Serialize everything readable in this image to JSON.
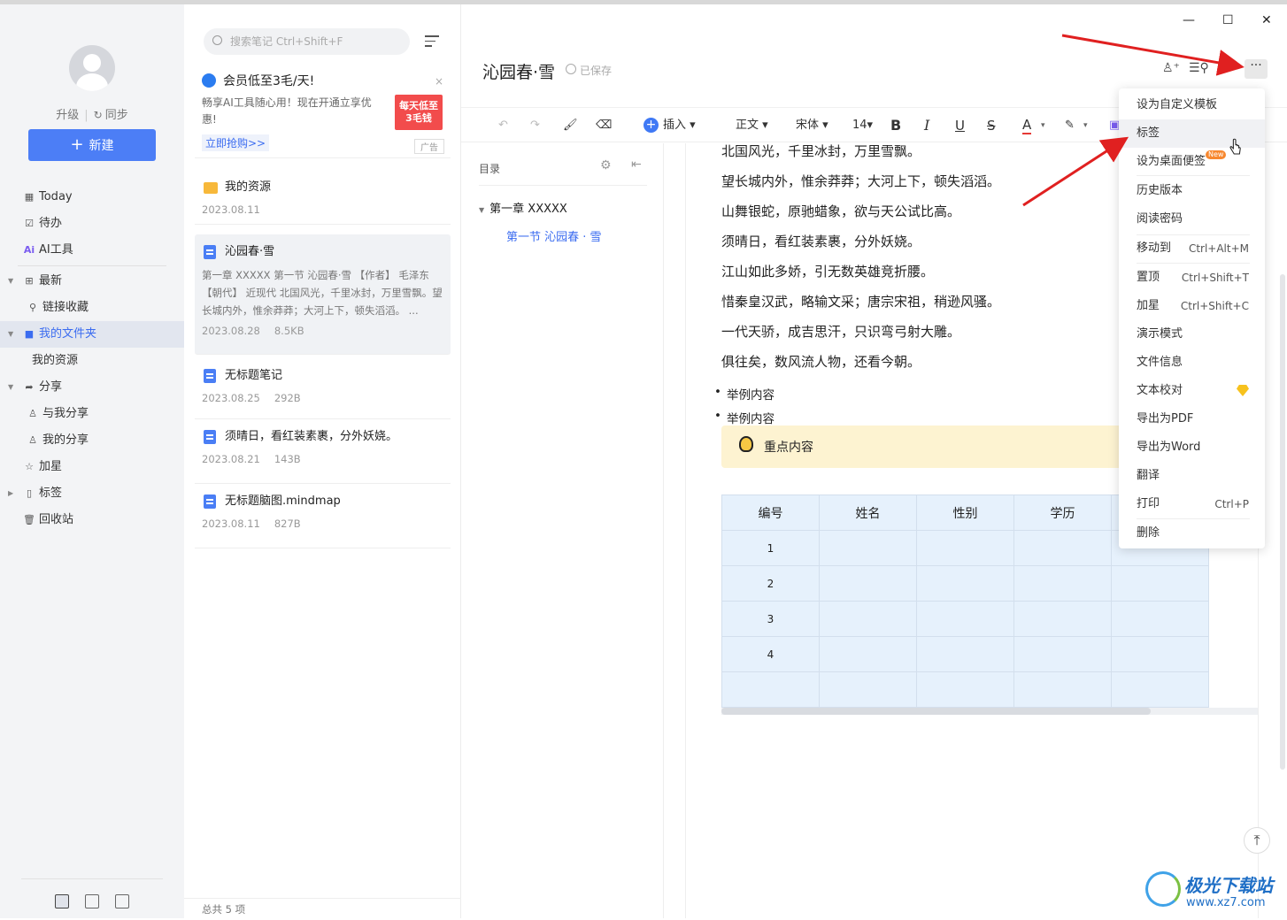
{
  "sidebar": {
    "upgrade": "升级",
    "sync": "同步",
    "new_button": "新建",
    "items": [
      {
        "label": "Today"
      },
      {
        "label": "待办"
      },
      {
        "label": "AI工具"
      },
      {
        "label": "最新"
      },
      {
        "label": "链接收藏"
      },
      {
        "label": "我的文件夹"
      },
      {
        "label": "我的资源"
      },
      {
        "label": "分享"
      },
      {
        "label": "与我分享"
      },
      {
        "label": "我的分享"
      },
      {
        "label": "加星"
      },
      {
        "label": "标签"
      },
      {
        "label": "回收站"
      }
    ]
  },
  "notelist": {
    "search_placeholder": "搜索笔记 Ctrl+Shift+F",
    "ad": {
      "title": "会员低至3毛/天!",
      "text": "畅享AI工具随心用！现在开通立享优惠!",
      "link": "立即抢购>>",
      "image_line1": "每天低至",
      "image_line2": "3毛钱",
      "tag": "广告"
    },
    "notes": [
      {
        "title": "我的资源",
        "date": "2023.08.11",
        "size": "",
        "snippet": ""
      },
      {
        "title": "沁园春·雪",
        "date": "2023.08.28",
        "size": "8.5KB",
        "snippet": "第一章 XXXXX 第一节 沁园春·雪 【作者】 毛泽东 【朝代】 近现代 北国风光，千里冰封，万里雪飘。望长城内外，惟余莽莽；大河上下，顿失滔滔。 ..."
      },
      {
        "title": "无标题笔记",
        "date": "2023.08.25",
        "size": "292B",
        "snippet": ""
      },
      {
        "title": "须晴日，看红装素裹，分外妖娆。",
        "date": "2023.08.21",
        "size": "143B",
        "snippet": ""
      },
      {
        "title": "无标题脑图.mindmap",
        "date": "2023.08.11",
        "size": "827B",
        "snippet": ""
      }
    ],
    "footer": "总共 5 项"
  },
  "editor": {
    "title": "沁园春·雪",
    "saved": "已保存",
    "toolbar": {
      "insert": "插入",
      "style": "正文",
      "font": "宋体",
      "size": "14",
      "bold": "B",
      "italic": "I",
      "underline": "U",
      "strike": "S",
      "color": "A"
    },
    "outline": {
      "label": "目录",
      "chapter": "第一章  XXXXX",
      "section": "第一节 沁园春 · 雪"
    },
    "poem": [
      "北国风光，千里冰封，万里雪飘。",
      "望长城内外，惟余莽莽；大河上下，顿失滔滔。",
      "山舞银蛇，原驰蜡象，欲与天公试比高。",
      "须晴日，看红装素裹，分外妖娆。",
      "江山如此多娇，引无数英雄竞折腰。",
      "惜秦皇汉武，略输文采；唐宗宋祖，稍逊风骚。",
      "一代天骄，成吉思汗，只识弯弓射大雕。",
      "俱往矣，数风流人物，还看今朝。"
    ],
    "bullets": [
      "举例内容",
      "举例内容"
    ],
    "callout": "重点内容",
    "table": {
      "headers": [
        "编号",
        "姓名",
        "性别",
        "学历",
        ""
      ],
      "rows": [
        [
          "1",
          "",
          "",
          "",
          ""
        ],
        [
          "2",
          "",
          "",
          "",
          ""
        ],
        [
          "3",
          "",
          "",
          "",
          ""
        ],
        [
          "4",
          "",
          "",
          "",
          ""
        ],
        [
          "",
          "",
          "",
          "",
          ""
        ]
      ]
    }
  },
  "menu": {
    "items": [
      {
        "label": "设为自定义模板",
        "shortcut": ""
      },
      {
        "label": "标签",
        "shortcut": ""
      },
      {
        "label": "设为桌面便签",
        "shortcut": "",
        "badge": "New"
      },
      {
        "label": "历史版本",
        "shortcut": ""
      },
      {
        "label": "阅读密码",
        "shortcut": ""
      },
      {
        "label": "移动到",
        "shortcut": "Ctrl+Alt+M"
      },
      {
        "label": "置顶",
        "shortcut": "Ctrl+Shift+T"
      },
      {
        "label": "加星",
        "shortcut": "Ctrl+Shift+C"
      },
      {
        "label": "演示模式",
        "shortcut": ""
      },
      {
        "label": "文件信息",
        "shortcut": ""
      },
      {
        "label": "文本校对",
        "shortcut": ""
      },
      {
        "label": "导出为PDF",
        "shortcut": ""
      },
      {
        "label": "导出为Word",
        "shortcut": ""
      },
      {
        "label": "翻译",
        "shortcut": ""
      },
      {
        "label": "打印",
        "shortcut": "Ctrl+P"
      },
      {
        "label": "删除",
        "shortcut": ""
      }
    ]
  },
  "watermark": {
    "name": "极光下载站",
    "url": "www.xz7.com"
  },
  "colors": {
    "accent": "#4c7ef6",
    "annotation_arrow": "#e02020"
  }
}
